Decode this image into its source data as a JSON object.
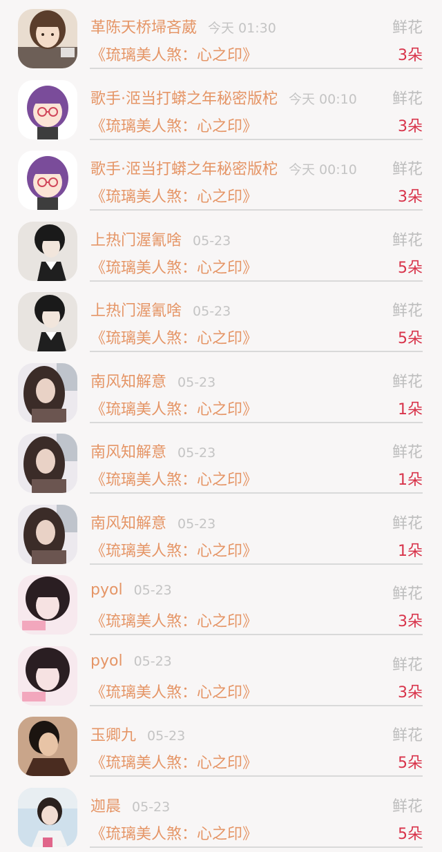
{
  "items": [
    {
      "name": "革陈天桥埽吝葳",
      "time": "今天 01:30",
      "gift": "鲜花",
      "title": "《琉璃美人煞：心之印》",
      "count": "3朵",
      "avatar": "girl-brown-hair"
    },
    {
      "name": "歌手·洍当打蟒之年秘密版柁",
      "time": "今天 00:10",
      "gift": "鲜花",
      "title": "《琉璃美人煞：心之印》",
      "count": "3朵",
      "avatar": "cartoon-purple-hair-glasses"
    },
    {
      "name": "歌手·洍当打蟒之年秘密版柁",
      "time": "今天 00:10",
      "gift": "鲜花",
      "title": "《琉璃美人煞：心之印》",
      "count": "3朵",
      "avatar": "cartoon-purple-hair-glasses"
    },
    {
      "name": "上热门渥氰啥",
      "time": "05-23",
      "gift": "鲜花",
      "title": "《琉璃美人煞：心之印》",
      "count": "5朵",
      "avatar": "anime-boy-black-hair"
    },
    {
      "name": "上热门渥氰啥",
      "time": "05-23",
      "gift": "鲜花",
      "title": "《琉璃美人煞：心之印》",
      "count": "5朵",
      "avatar": "anime-boy-black-hair"
    },
    {
      "name": "南风知解意",
      "time": "05-23",
      "gift": "鲜花",
      "title": "《琉璃美人煞：心之印》",
      "count": "1朵",
      "avatar": "girl-long-dark-hair"
    },
    {
      "name": "南风知解意",
      "time": "05-23",
      "gift": "鲜花",
      "title": "《琉璃美人煞：心之印》",
      "count": "1朵",
      "avatar": "girl-long-dark-hair"
    },
    {
      "name": "南风知解意",
      "time": "05-23",
      "gift": "鲜花",
      "title": "《琉璃美人煞：心之印》",
      "count": "1朵",
      "avatar": "girl-long-dark-hair"
    },
    {
      "name": "pyol",
      "time": "05-23",
      "gift": "鲜花",
      "title": "《琉璃美人煞：心之印》",
      "count": "3朵",
      "avatar": "girl-bangs-pink"
    },
    {
      "name": "pyol",
      "time": "05-23",
      "gift": "鲜花",
      "title": "《琉璃美人煞：心之印》",
      "count": "3朵",
      "avatar": "girl-bangs-pink"
    },
    {
      "name": "玉卿九",
      "time": "05-23",
      "gift": "鲜花",
      "title": "《琉璃美人煞：心之印》",
      "count": "5朵",
      "avatar": "woman-dark-warm"
    },
    {
      "name": "迦晨",
      "time": "05-23",
      "gift": "鲜花",
      "title": "《琉璃美人煞：心之印》",
      "count": "5朵",
      "avatar": "girl-outdoor-blue"
    }
  ],
  "colors": {
    "name_text": "#e59566",
    "count_text": "#d8334a",
    "muted_text": "#c4c4c4",
    "background": "#f8f6f6"
  }
}
